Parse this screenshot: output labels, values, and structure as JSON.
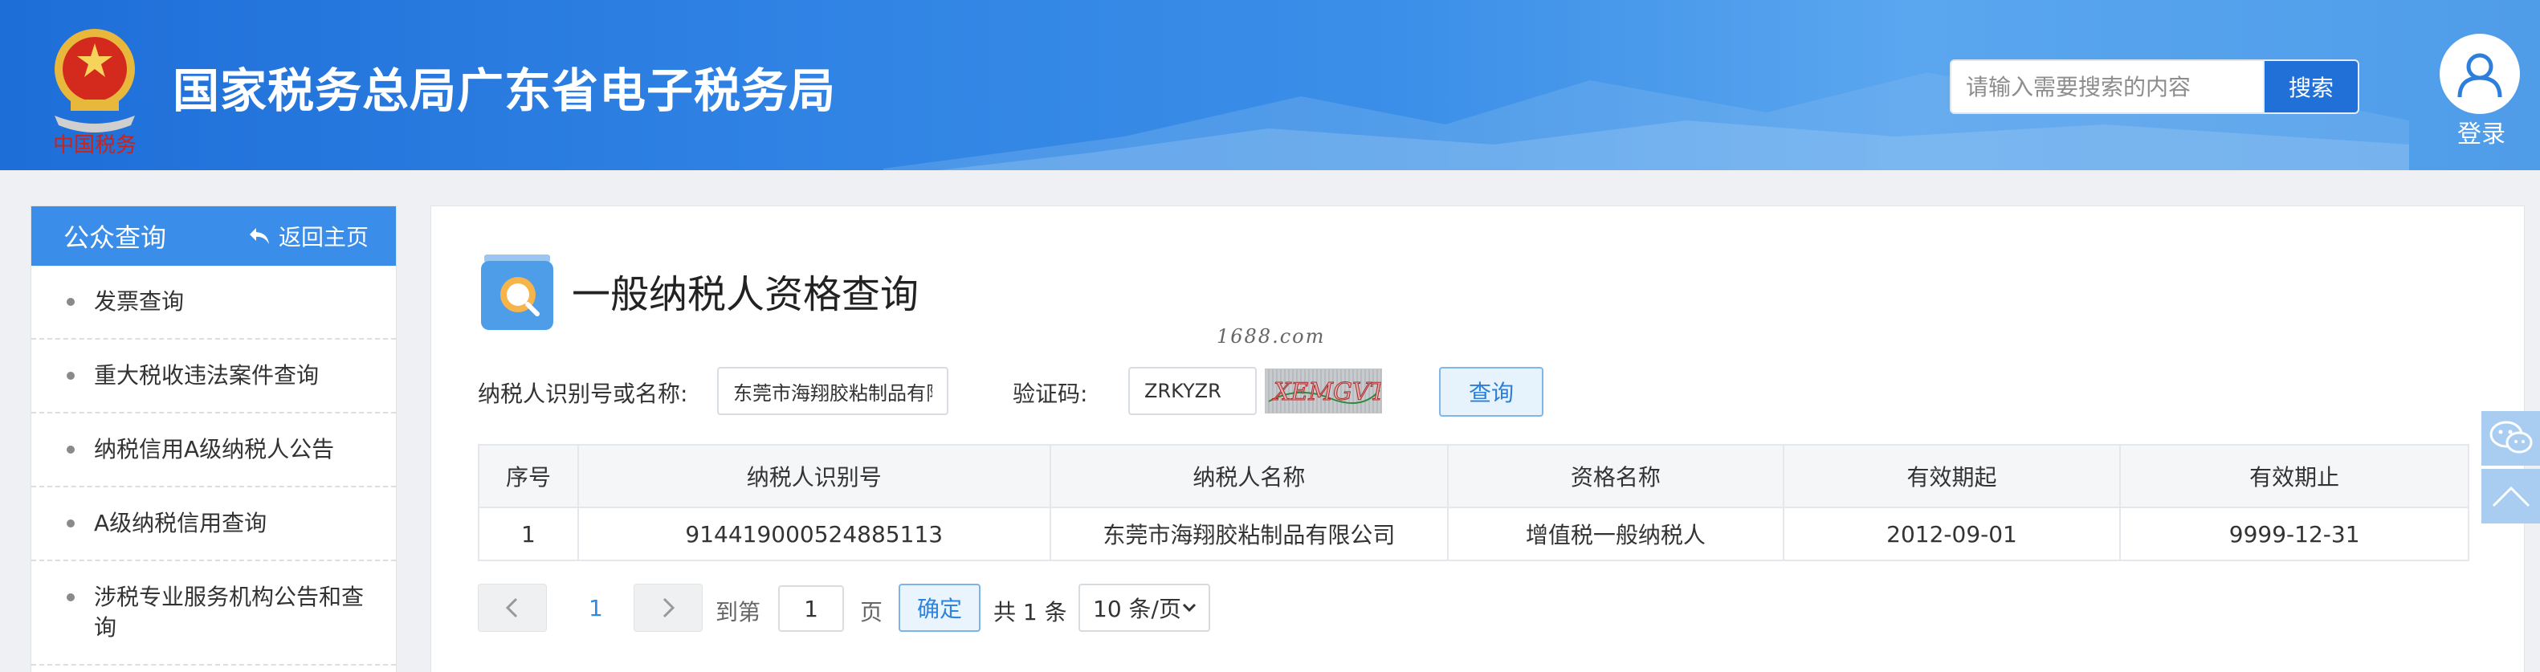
{
  "header": {
    "site_title": "国家税务总局广东省电子税务局",
    "logo_caption": "中国税务",
    "search_placeholder": "请输入需要搜索的内容",
    "search_button": "搜索",
    "login_label": "登录"
  },
  "sidebar": {
    "title": "公众查询",
    "back_home": "返回主页",
    "items": [
      {
        "label": "发票查询"
      },
      {
        "label": "重大税收违法案件查询"
      },
      {
        "label": "纳税信用A级纳税人公告"
      },
      {
        "label": "A级纳税信用查询"
      },
      {
        "label": "涉税专业服务机构公告和查询"
      }
    ]
  },
  "main": {
    "title": "一般纳税人资格查询",
    "watermark": "1688.com",
    "form": {
      "taxpayer_label": "纳税人识别号或名称:",
      "taxpayer_value": "东莞市海翔胶粘制品有限",
      "captcha_label": "验证码:",
      "captcha_value": "ZRKYZR",
      "captcha_image_text": "XEMGVT",
      "query_button": "查询"
    },
    "table": {
      "headers": [
        "序号",
        "纳税人识别号",
        "纳税人名称",
        "资格名称",
        "有效期起",
        "有效期止"
      ],
      "rows": [
        [
          "1",
          "914419000524885113",
          "东莞市海翔胶粘制品有限公司",
          "增值税一般纳税人",
          "2012-09-01",
          "9999-12-31"
        ]
      ]
    },
    "pagination": {
      "current_page": "1",
      "goto_label": "到第",
      "goto_value": "1",
      "page_unit": "页",
      "confirm": "确定",
      "total": "共 1 条",
      "page_size": "10 条/页"
    }
  },
  "colors": {
    "brand_blue": "#2170d8",
    "sidebar_head": "#3a8eea",
    "link_blue": "#2d8be6"
  }
}
